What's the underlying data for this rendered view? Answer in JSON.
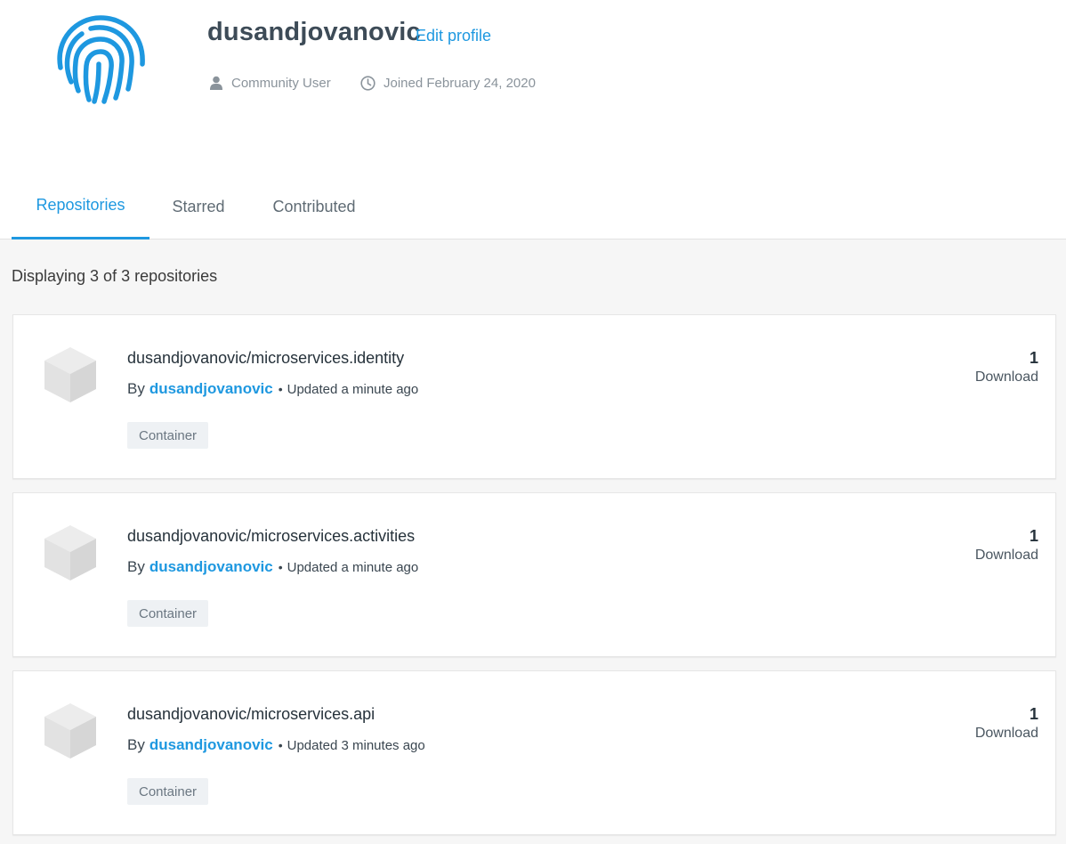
{
  "profile": {
    "username": "dusandjovanovic",
    "edit_label": "Edit profile",
    "role": "Community User",
    "joined": "Joined February 24, 2020",
    "avatar_icon": "fingerprint-icon",
    "accent_color": "#1e98e0"
  },
  "tabs": [
    {
      "label": "Repositories",
      "active": true
    },
    {
      "label": "Starred",
      "active": false
    },
    {
      "label": "Contributed",
      "active": false
    }
  ],
  "list": {
    "count_text": "Displaying 3 of 3 repositories"
  },
  "repositories": [
    {
      "name": "dusandjovanovic/microservices.identity",
      "by_label": "By",
      "owner": "dusandjovanovic",
      "updated": "Updated a minute ago",
      "badge": "Container",
      "downloads": "1",
      "downloads_label": "Download"
    },
    {
      "name": "dusandjovanovic/microservices.activities",
      "by_label": "By",
      "owner": "dusandjovanovic",
      "updated": "Updated a minute ago",
      "badge": "Container",
      "downloads": "1",
      "downloads_label": "Download"
    },
    {
      "name": "dusandjovanovic/microservices.api",
      "by_label": "By",
      "owner": "dusandjovanovic",
      "updated": "Updated 3 minutes ago",
      "badge": "Container",
      "downloads": "1",
      "downloads_label": "Download"
    }
  ]
}
